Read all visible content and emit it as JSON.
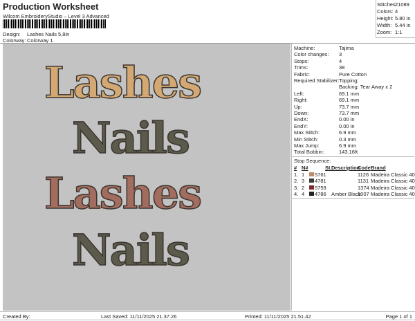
{
  "header": {
    "title": "Production Worksheet",
    "subtitle": "Wilcom EmbroideryStudio – Level 3 Advanced",
    "design_label": "Design:",
    "design": "Lashes Nails 5,8in",
    "colorway_label": "Colorway:",
    "colorway": "Colorway 1"
  },
  "stats": [
    {
      "label": "Stitches:",
      "value": "21089"
    },
    {
      "label": "Colors:",
      "value": "4"
    },
    {
      "label": "Height:",
      "value": "5.80 in"
    },
    {
      "label": "Width:",
      "value": "5.44 in"
    },
    {
      "label": "Zoom:",
      "value": "1:1"
    }
  ],
  "design_words": [
    {
      "text": "Lashes",
      "color": "#d3a873"
    },
    {
      "text": "Nails",
      "color": "#5b5a4b"
    },
    {
      "text": "Lashes",
      "color": "#a26c5e"
    },
    {
      "text": "Nails",
      "color": "#5b5a4b"
    }
  ],
  "details": [
    {
      "label": "Machine:",
      "value": "Tajima"
    },
    {
      "label": "Color changes:",
      "value": "3"
    },
    {
      "label": "Stops:",
      "value": "4"
    },
    {
      "label": "Trims:",
      "value": "38"
    },
    {
      "label": "Fabric:",
      "value": "Pure Cotton"
    },
    {
      "label": "Required Stabilizer:",
      "value": "Topping:",
      "value2": "Backing: Tear Away x 2"
    },
    {
      "label": "Left:",
      "value": "69.1 mm"
    },
    {
      "label": "Right:",
      "value": "69.1 mm"
    },
    {
      "label": "Up:",
      "value": "73.7 mm"
    },
    {
      "label": "Down:",
      "value": "73.7 mm"
    },
    {
      "label": "EndX:",
      "value": "0.00 in"
    },
    {
      "label": "EndY:",
      "value": "0.00 in"
    },
    {
      "label": "Max Stitch:",
      "value": "6.9 mm"
    },
    {
      "label": "Min Stitch:",
      "value": "0.3 mm"
    },
    {
      "label": "Max Jump:",
      "value": "6.9 mm"
    },
    {
      "label": "Total Bobbin:",
      "value": "143.16ft"
    }
  ],
  "stop_sequence": {
    "title": "Stop Sequence:",
    "headers": [
      "#",
      "N#",
      "St.",
      "Description",
      "Code",
      "Brand"
    ],
    "rows": [
      {
        "num": "1.",
        "n": "1",
        "color": "#c08a68",
        "st": "5761",
        "desc": "",
        "code": "1126",
        "brand": "Madeira Classic 40"
      },
      {
        "num": "2.",
        "n": "3",
        "color": "#3a3a38",
        "st": "4781",
        "desc": "",
        "code": "1131",
        "brand": "Madeira Classic 40"
      },
      {
        "num": "3.",
        "n": "2",
        "color": "#7a2a2c",
        "st": "5759",
        "desc": "",
        "code": "1374",
        "brand": "Madeira Classic 40"
      },
      {
        "num": "4.",
        "n": "4",
        "color": "#222222",
        "st": "4786",
        "desc": "Amber Black",
        "code": "1007",
        "brand": "Madeira Classic 40"
      }
    ]
  },
  "footer": {
    "created": "Created By:",
    "saved": "Last Saved: 11/11/2025 21.37.26",
    "printed": "Printed: 11/11/2025 21.51.42",
    "page": "Page 1 of 1"
  }
}
